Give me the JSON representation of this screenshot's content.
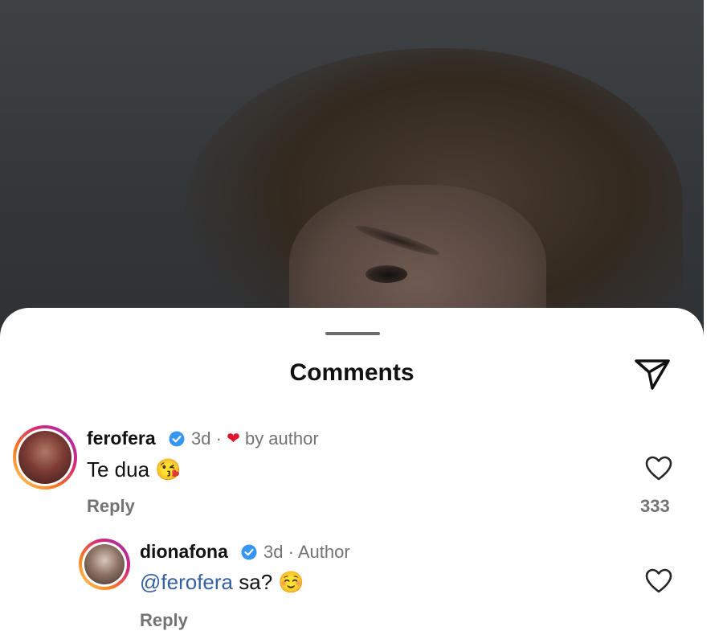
{
  "sheet": {
    "title": "Comments"
  },
  "comments": [
    {
      "username": "ferofera",
      "time": "3d",
      "separator": "·",
      "liked_by": "by author",
      "text": "Te dua",
      "emoji": "😘",
      "reply_label": "Reply",
      "likes": "333"
    },
    {
      "username": "dionafona",
      "time": "3d",
      "separator": "·",
      "role": "Author",
      "mention": "@ferofera",
      "text": "sa?",
      "emoji": "☺️",
      "reply_label": "Reply"
    }
  ],
  "colors": {
    "accent_mention": "#3561a0",
    "verified": "#3797f0",
    "heart": "#e3162f"
  },
  "icons": {
    "send": "paper-plane-icon",
    "like": "heart-outline-icon",
    "verified": "verified-badge-icon"
  }
}
